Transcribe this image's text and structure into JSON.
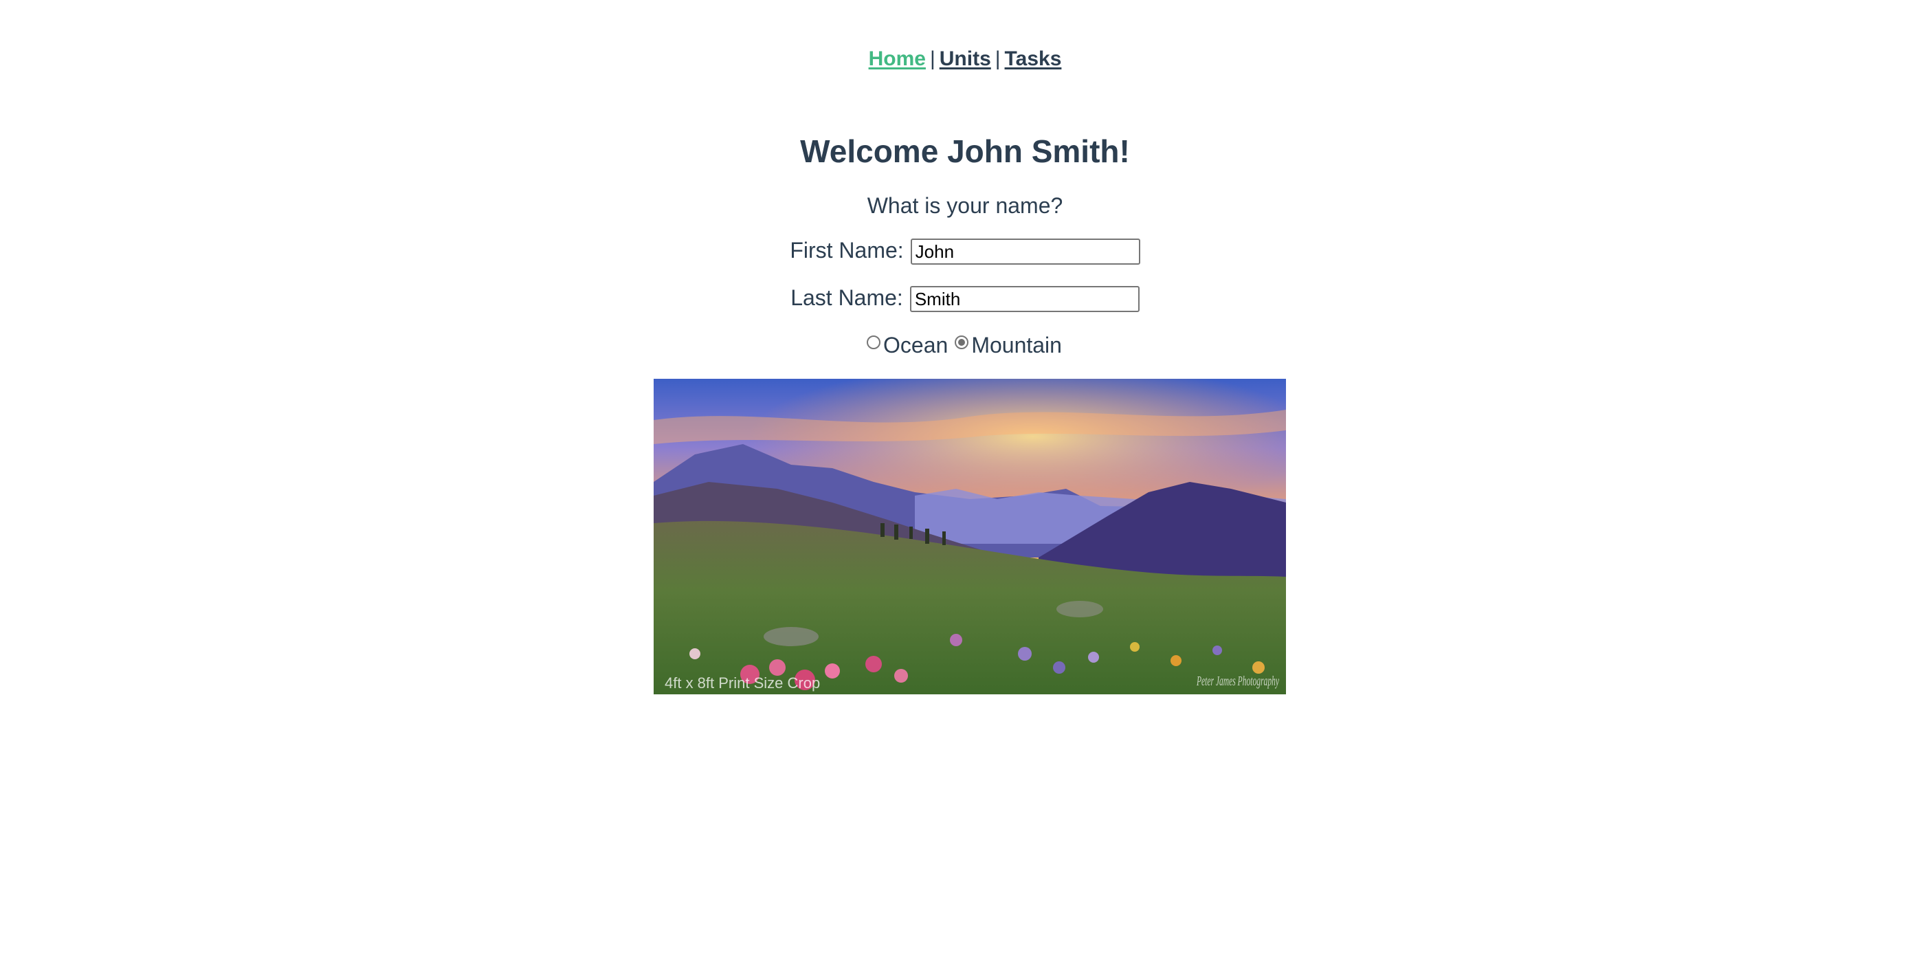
{
  "nav": {
    "home": "Home",
    "units": "Units",
    "tasks": "Tasks",
    "separator": "|"
  },
  "heading": "Welcome John Smith!",
  "question": "What is your name?",
  "form": {
    "first_name_label": "First Name:",
    "first_name_value": "John",
    "last_name_label": "Last Name:",
    "last_name_value": "Smith"
  },
  "radios": {
    "ocean_label": "Ocean",
    "mountain_label": "Mountain",
    "selected": "Mountain"
  },
  "photo": {
    "caption": "4ft x 8ft Print Size Crop",
    "watermark": "Peter James Photography"
  },
  "colors": {
    "text": "#2c3e50",
    "active_link": "#42b983"
  }
}
